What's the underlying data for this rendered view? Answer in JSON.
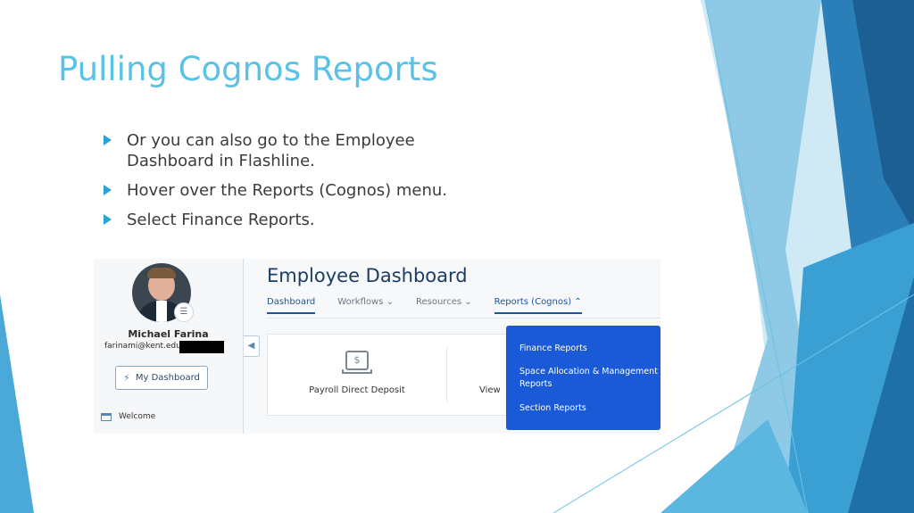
{
  "slide": {
    "title": "Pulling Cognos Reports",
    "bullets": [
      "Or you can also go to the Employee Dashboard in Flashline.",
      "Hover over the Reports (Cognos) menu.",
      "Select Finance Reports."
    ]
  },
  "screenshot": {
    "profile": {
      "name": "Michael Farina",
      "email": "farinami@kent.edu",
      "dashboard_button": "My Dashboard",
      "welcome_link": "Welcome"
    },
    "header": {
      "title": "Employee Dashboard"
    },
    "tabs": [
      {
        "label": "Dashboard"
      },
      {
        "label": "Workflows"
      },
      {
        "label": "Resources"
      },
      {
        "label": "Reports (Cognos)"
      }
    ],
    "cards": {
      "payroll_label": "Payroll Direct Deposit",
      "second_label": "View"
    },
    "reports_menu": [
      "Finance Reports",
      "Space Allocation & Management Reports",
      "Section Reports"
    ]
  },
  "colors": {
    "title": "#5bc2e7",
    "bullet_arrow": "#2aa3d9",
    "menu_bg": "#1a5ad7",
    "nav_active": "#1a5599"
  }
}
